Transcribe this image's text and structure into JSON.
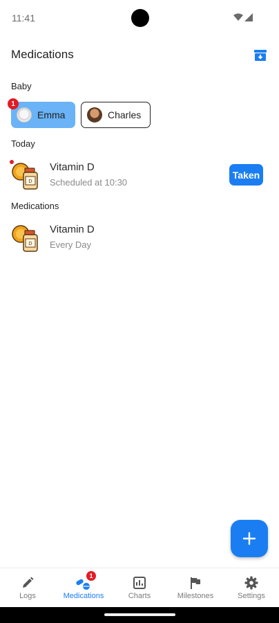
{
  "status_bar": {
    "time": "11:41"
  },
  "header": {
    "title": "Medications"
  },
  "baby_section": {
    "label": "Baby",
    "babies": [
      {
        "name": "Emma",
        "selected": true,
        "badge": "1"
      },
      {
        "name": "Charles",
        "selected": false
      }
    ]
  },
  "today_section": {
    "label": "Today",
    "items": [
      {
        "name": "Vitamin D",
        "subtitle": "Scheduled at 10:30",
        "action_label": "Taken"
      }
    ]
  },
  "medications_section": {
    "label": "Medications",
    "items": [
      {
        "name": "Vitamin D",
        "subtitle": "Every Day"
      }
    ]
  },
  "bottom_nav": {
    "items": [
      {
        "label": "Logs",
        "icon": "pencil-icon"
      },
      {
        "label": "Medications",
        "icon": "pills-icon",
        "active": true,
        "badge": "1"
      },
      {
        "label": "Charts",
        "icon": "chart-icon"
      },
      {
        "label": "Milestones",
        "icon": "flag-icon"
      },
      {
        "label": "Settings",
        "icon": "gear-icon"
      }
    ]
  },
  "colors": {
    "accent": "#1a7ef2",
    "selected_chip": "#6ab3f6",
    "badge": "#e31c24"
  }
}
